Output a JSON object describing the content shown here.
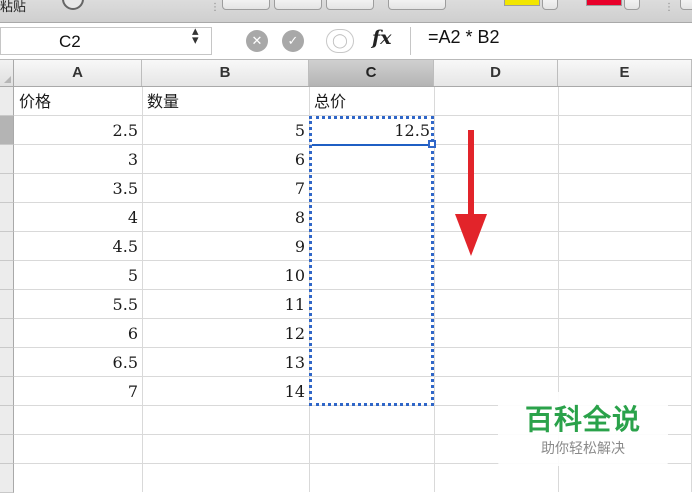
{
  "toolbar": {
    "partial_label": "粘贴"
  },
  "formula_bar": {
    "cell_ref": "C2",
    "formula": "=A2 * B2",
    "fx_label": "fx"
  },
  "columns": [
    "A",
    "B",
    "C",
    "D",
    "E"
  ],
  "rows": [
    {
      "a": "价格",
      "b": "数量",
      "c": "总价"
    },
    {
      "a": "2.5",
      "b": "5",
      "c": "12.5"
    },
    {
      "a": "3",
      "b": "6",
      "c": ""
    },
    {
      "a": "3.5",
      "b": "7",
      "c": ""
    },
    {
      "a": "4",
      "b": "8",
      "c": ""
    },
    {
      "a": "4.5",
      "b": "9",
      "c": ""
    },
    {
      "a": "5",
      "b": "10",
      "c": ""
    },
    {
      "a": "5.5",
      "b": "11",
      "c": ""
    },
    {
      "a": "6",
      "b": "12",
      "c": ""
    },
    {
      "a": "6.5",
      "b": "13",
      "c": ""
    },
    {
      "a": "7",
      "b": "14",
      "c": ""
    }
  ],
  "watermark": {
    "title": "百科全说",
    "subtitle": "助你轻松解决"
  },
  "colors": {
    "selection": "#2f66c8",
    "arrow": "#e2242a",
    "watermark_green": "#2aa24a",
    "toolbar_yellow": "#f2e600",
    "toolbar_red": "#e8002a"
  }
}
